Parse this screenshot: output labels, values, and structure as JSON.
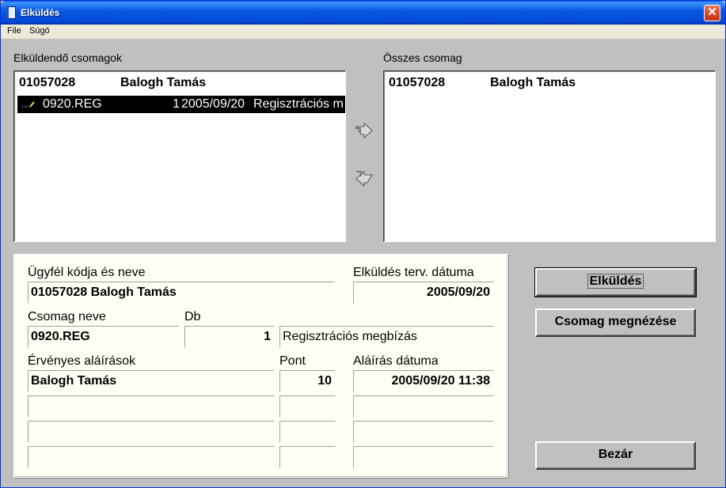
{
  "window": {
    "title": "Elküldés"
  },
  "menu": {
    "file": "File",
    "help": "Súgó"
  },
  "lists": {
    "pending_label": "Elküldendő csomagok",
    "all_label": "Összes csomag",
    "pending_header": {
      "code": "01057028",
      "name": "Balogh Tamás"
    },
    "pending_selected": {
      "file": "0920.REG",
      "count": "1",
      "date": "2005/09/20",
      "desc": "Regisztrációs m"
    },
    "all_header": {
      "code": "01057028",
      "name": "Balogh Tamás"
    }
  },
  "details": {
    "client_label": "Ügyfél kódja és neve",
    "client_value": "01057028  Balogh Tamás",
    "send_date_label": "Elküldés terv. dátuma",
    "send_date_value": "2005/09/20",
    "package_label": "Csomag neve",
    "package_value": "0920.REG",
    "qty_label": "Db",
    "qty_value": "1",
    "package_desc": "Regisztrációs megbízás",
    "signatures_label": "Érvényes aláírások",
    "points_label": "Pont",
    "sign_date_label": "Aláírás dátuma",
    "signatures": [
      {
        "name": "Balogh Tamás",
        "points": "10",
        "date": "2005/09/20 11:38"
      },
      {
        "name": "",
        "points": "",
        "date": ""
      },
      {
        "name": "",
        "points": "",
        "date": ""
      },
      {
        "name": "",
        "points": "",
        "date": ""
      }
    ]
  },
  "buttons": {
    "send": "Elküldés",
    "view": "Csomag megnézése",
    "close": "Bezár"
  },
  "icons": {
    "close": "close-icon",
    "move_right": "arrow-right-icon",
    "move_left": "arrow-left-icon",
    "package": "package-icon"
  }
}
